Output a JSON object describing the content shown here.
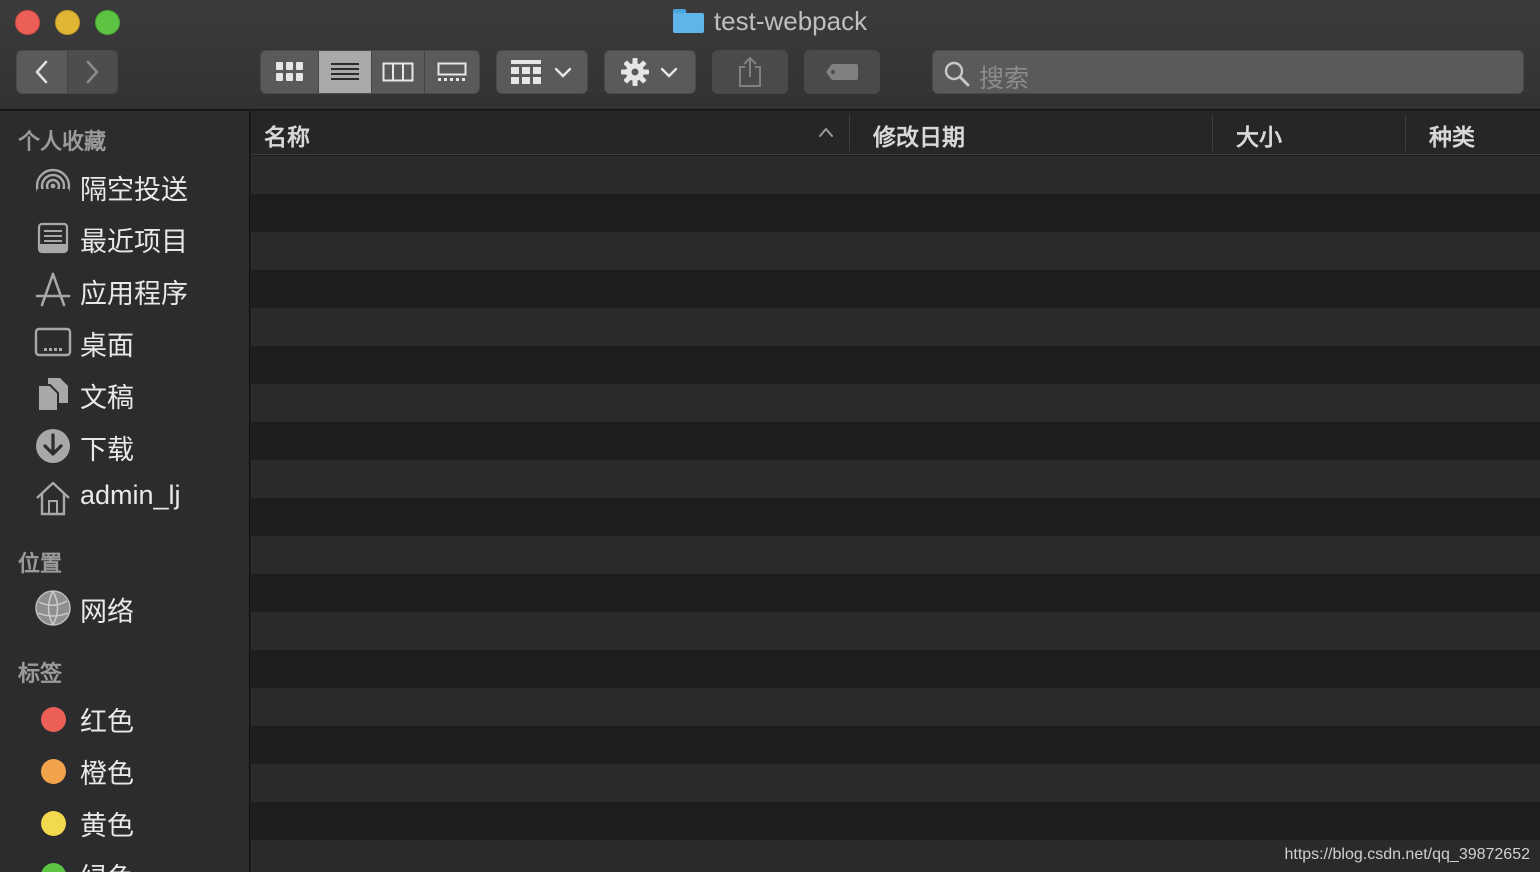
{
  "window": {
    "title": "test-webpack"
  },
  "toolbar": {
    "search_placeholder": "搜索",
    "view_modes": [
      "icon-view",
      "list-view",
      "column-view",
      "gallery-view"
    ],
    "active_view": "list-view"
  },
  "sidebar": {
    "favorites_header": "个人收藏",
    "favorites": [
      {
        "label": "隔空投送",
        "icon": "airdrop-icon"
      },
      {
        "label": "最近项目",
        "icon": "recents-icon"
      },
      {
        "label": "应用程序",
        "icon": "applications-icon"
      },
      {
        "label": "桌面",
        "icon": "desktop-icon"
      },
      {
        "label": "文稿",
        "icon": "documents-icon"
      },
      {
        "label": "下载",
        "icon": "downloads-icon"
      },
      {
        "label": "admin_lj",
        "icon": "home-icon"
      }
    ],
    "locations_header": "位置",
    "locations": [
      {
        "label": "网络",
        "icon": "network-icon"
      }
    ],
    "tags_header": "标签",
    "tags": [
      {
        "label": "红色",
        "color": "#ec5f57"
      },
      {
        "label": "橙色",
        "color": "#f0a34a"
      },
      {
        "label": "黄色",
        "color": "#f2d94e"
      },
      {
        "label": "绿色",
        "color": "#5cc343"
      }
    ]
  },
  "list": {
    "columns": {
      "name": "名称",
      "modified": "修改日期",
      "size": "大小",
      "kind": "种类"
    },
    "sort_column": "name"
  },
  "watermark": "https://blog.csdn.net/qq_39872652"
}
